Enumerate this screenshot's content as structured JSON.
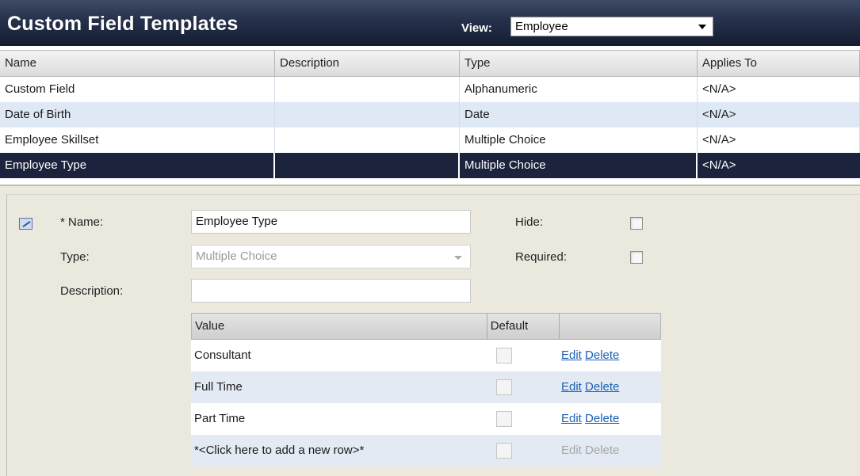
{
  "header": {
    "title": "Custom Field Templates",
    "view_label": "View:",
    "view_value": "Employee"
  },
  "grid": {
    "columns": [
      "Name",
      "Description",
      "Type",
      "Applies To"
    ],
    "rows": [
      {
        "name": "Custom Field",
        "description": "",
        "type": "Alphanumeric",
        "applies_to": "<N/A>"
      },
      {
        "name": "Date of Birth",
        "description": "",
        "type": "Date",
        "applies_to": "<N/A>"
      },
      {
        "name": "Employee Skillset",
        "description": "",
        "type": "Multiple Choice",
        "applies_to": "<N/A>"
      },
      {
        "name": "Employee Type",
        "description": "",
        "type": "Multiple Choice",
        "applies_to": "<N/A>",
        "selected": true
      }
    ]
  },
  "form": {
    "icon": "edit-record-icon",
    "name_label": "* Name:",
    "name_value": "Employee Type",
    "type_label": "Type:",
    "type_value": "Multiple Choice",
    "description_label": "Description:",
    "description_value": "",
    "hide_label": "Hide:",
    "hide_checked": false,
    "required_label": "Required:",
    "required_checked": false
  },
  "values": {
    "columns": [
      "Value",
      "Default",
      ""
    ],
    "rows": [
      {
        "value": "Consultant",
        "default": false,
        "edit": "Edit",
        "delete": "Delete"
      },
      {
        "value": "Full Time",
        "default": false,
        "edit": "Edit",
        "delete": "Delete"
      },
      {
        "value": "Part Time",
        "default": false,
        "edit": "Edit",
        "delete": "Delete"
      },
      {
        "value": "*<Click here to add a new row>*",
        "default": false,
        "edit": "Edit",
        "delete": "Delete",
        "disabled": true
      }
    ]
  },
  "colors": {
    "header_bg": "#1c233d",
    "row_alt": "#dfe9f6",
    "row_selected": "#1c233d",
    "link": "#1a5fb4",
    "panel_bg": "#ebe9de"
  }
}
